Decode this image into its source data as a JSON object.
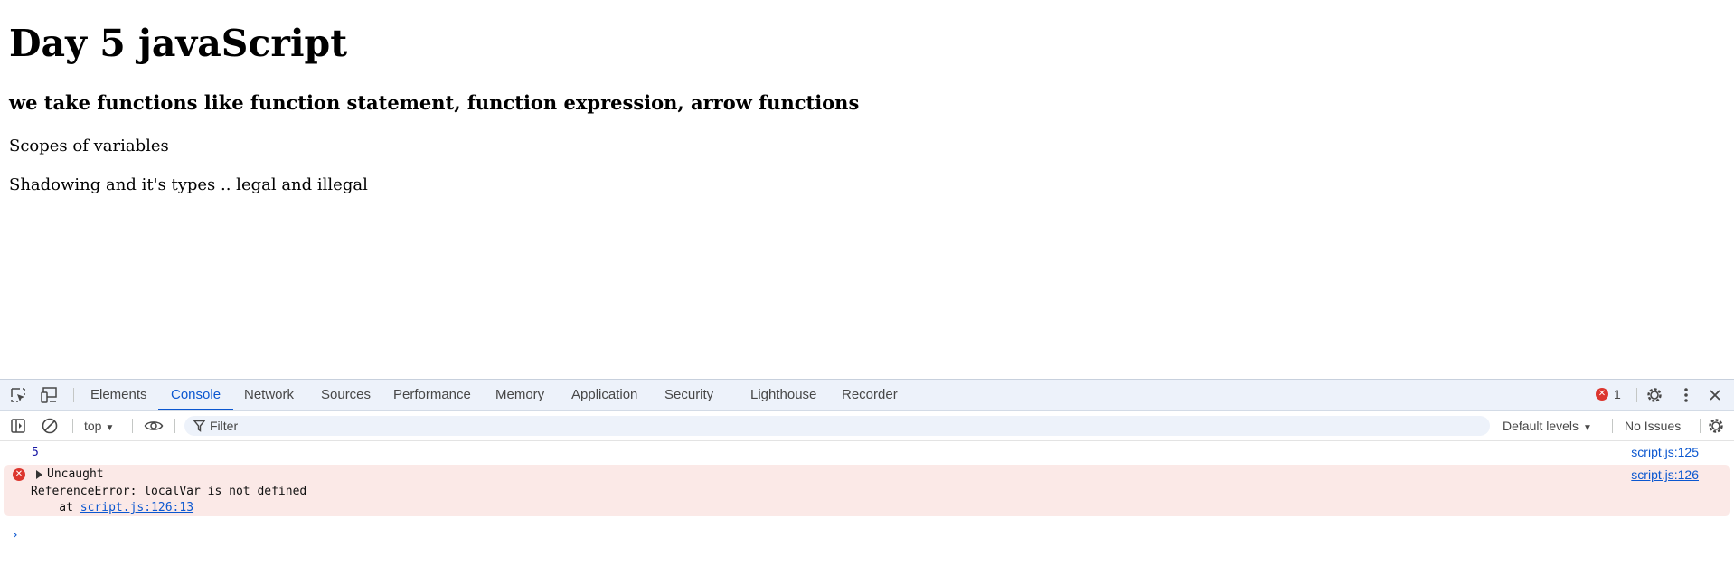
{
  "page": {
    "heading": "Day 5 javaScript",
    "subheading": "we take functions like function statement, function expression, arrow functions",
    "paragraphs": [
      "Scopes of variables",
      "Shadowing and it's types .. legal and illegal"
    ]
  },
  "devtools": {
    "tabs": [
      "Elements",
      "Console",
      "Network",
      "Sources",
      "Performance",
      "Memory",
      "Application",
      "Security",
      "Lighthouse",
      "Recorder"
    ],
    "active_tab": "Console",
    "error_count": "1",
    "toolbar": {
      "context": "top",
      "filter_placeholder": "Filter",
      "filter_value": "",
      "levels": "Default levels",
      "issues": "No Issues"
    },
    "console": {
      "log": {
        "value": "5",
        "source": "script.js:125"
      },
      "error": {
        "head": "Uncaught",
        "message": "ReferenceError: localVar is not defined",
        "at_prefix": "    at ",
        "at_link": "script.js:126:13",
        "source": "script.js:126"
      },
      "prompt": "›"
    },
    "colors": {
      "accent": "#0b57d0",
      "error": "#dc362e",
      "error_bg": "#fbe9e7",
      "tabbar_bg": "#edf2fa"
    },
    "icons": [
      "inspect-element-icon",
      "device-toggle-icon",
      "settings-gear-icon",
      "more-vertical-icon",
      "close-icon",
      "sidebar-toggle-icon",
      "clear-console-icon",
      "eye-icon",
      "filter-funnel-icon",
      "console-settings-icon"
    ]
  }
}
